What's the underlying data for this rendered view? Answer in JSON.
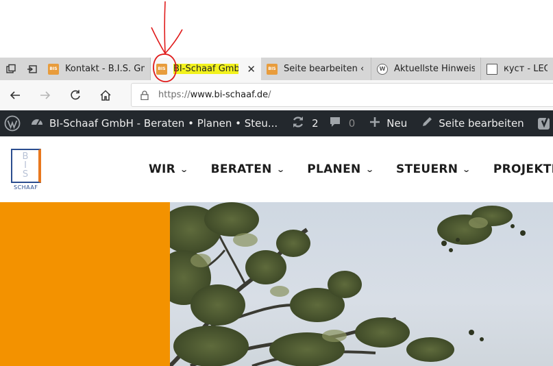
{
  "browser": {
    "tabs": [
      {
        "favicon": "bis-favicon",
        "title": "Kontakt - B.I.S. GmbH",
        "active": false
      },
      {
        "favicon": "bis-favicon",
        "title": "BI-Schaaf GmbH",
        "active": true
      },
      {
        "favicon": "bis-favicon",
        "title": "Seite bearbeiten ‹ BI-",
        "active": false
      },
      {
        "favicon": "wordpress-icon",
        "title": "Aktuellste Hinweise |",
        "active": false
      },
      {
        "favicon": "document-icon",
        "title": "куст - LEO: Ü",
        "active": false
      }
    ],
    "favicon_text": "BIS",
    "address": {
      "prefix": "https://",
      "host": "www.bi-schaaf.de",
      "path": "/"
    },
    "icons": [
      "tab-actions-icon",
      "set-aside-icon",
      "back-icon",
      "forward-icon",
      "refresh-icon",
      "home-icon",
      "lock-icon",
      "close-icon"
    ]
  },
  "adminbar": {
    "site_title": "BI-Schaaf GmbH - Beraten • Planen • Steu...",
    "updates_count": "2",
    "comments_count": "0",
    "new_label": "Neu",
    "edit_label": "Seite bearbeiten",
    "icons": [
      "wordpress-logo-icon",
      "dashboard-icon",
      "updates-icon",
      "comment-icon",
      "plus-icon",
      "pencil-icon",
      "yoast-icon",
      "status-dot-icon"
    ]
  },
  "site": {
    "logo_letters": "B\nI\nS",
    "logo_word": "SCHAAF",
    "nav": [
      {
        "label": "WIR",
        "dropdown": true
      },
      {
        "label": "BERATEN",
        "dropdown": true
      },
      {
        "label": "PLANEN",
        "dropdown": true
      },
      {
        "label": "STEUERN",
        "dropdown": true
      },
      {
        "label": "PROJEKTE",
        "dropdown": false
      }
    ]
  },
  "colors": {
    "orange": "#f39200",
    "adminbar": "#23282d",
    "tabstrip": "#d6d6d6",
    "highlight": "#f2f21c",
    "annotation": "#e01b1b",
    "logo_blue": "#2a4d8f"
  }
}
